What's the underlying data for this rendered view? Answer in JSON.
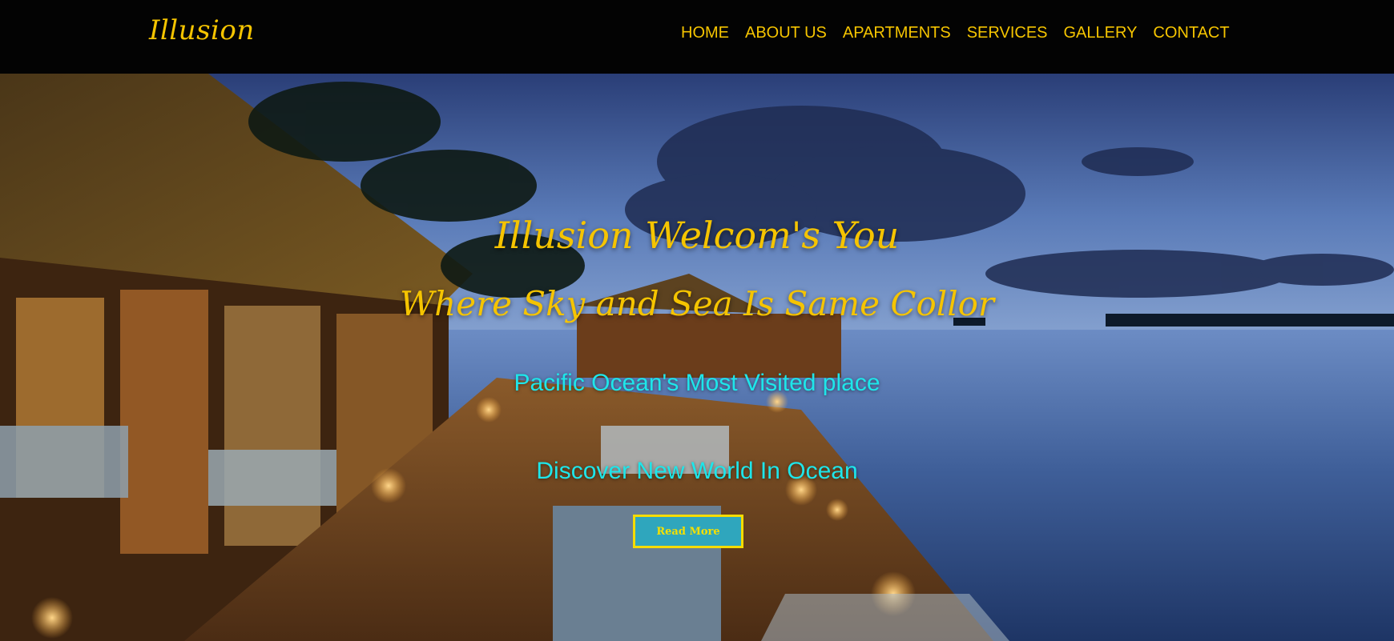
{
  "brand": {
    "logo": "Illusion"
  },
  "nav": {
    "items": [
      {
        "label": "HOME"
      },
      {
        "label": "ABOUT US"
      },
      {
        "label": "APARTMENTS"
      },
      {
        "label": "SERVICES"
      },
      {
        "label": "GALLERY"
      },
      {
        "label": "CONTACT"
      }
    ]
  },
  "hero": {
    "title": "Illusion Welcom's You",
    "subtitle": "Where Sky and Sea Is Same Collor",
    "tagline1": "Pacific Ocean's Most Visited place",
    "tagline2": "Discover New World In Ocean",
    "button_label": "Read More",
    "background_image": "resort-overwater-dusk-photo"
  },
  "colors": {
    "accent": "#f5c400",
    "tagline": "#1ee6ea",
    "button_bg": "#2fa6bd",
    "header_bg": "#030303"
  }
}
